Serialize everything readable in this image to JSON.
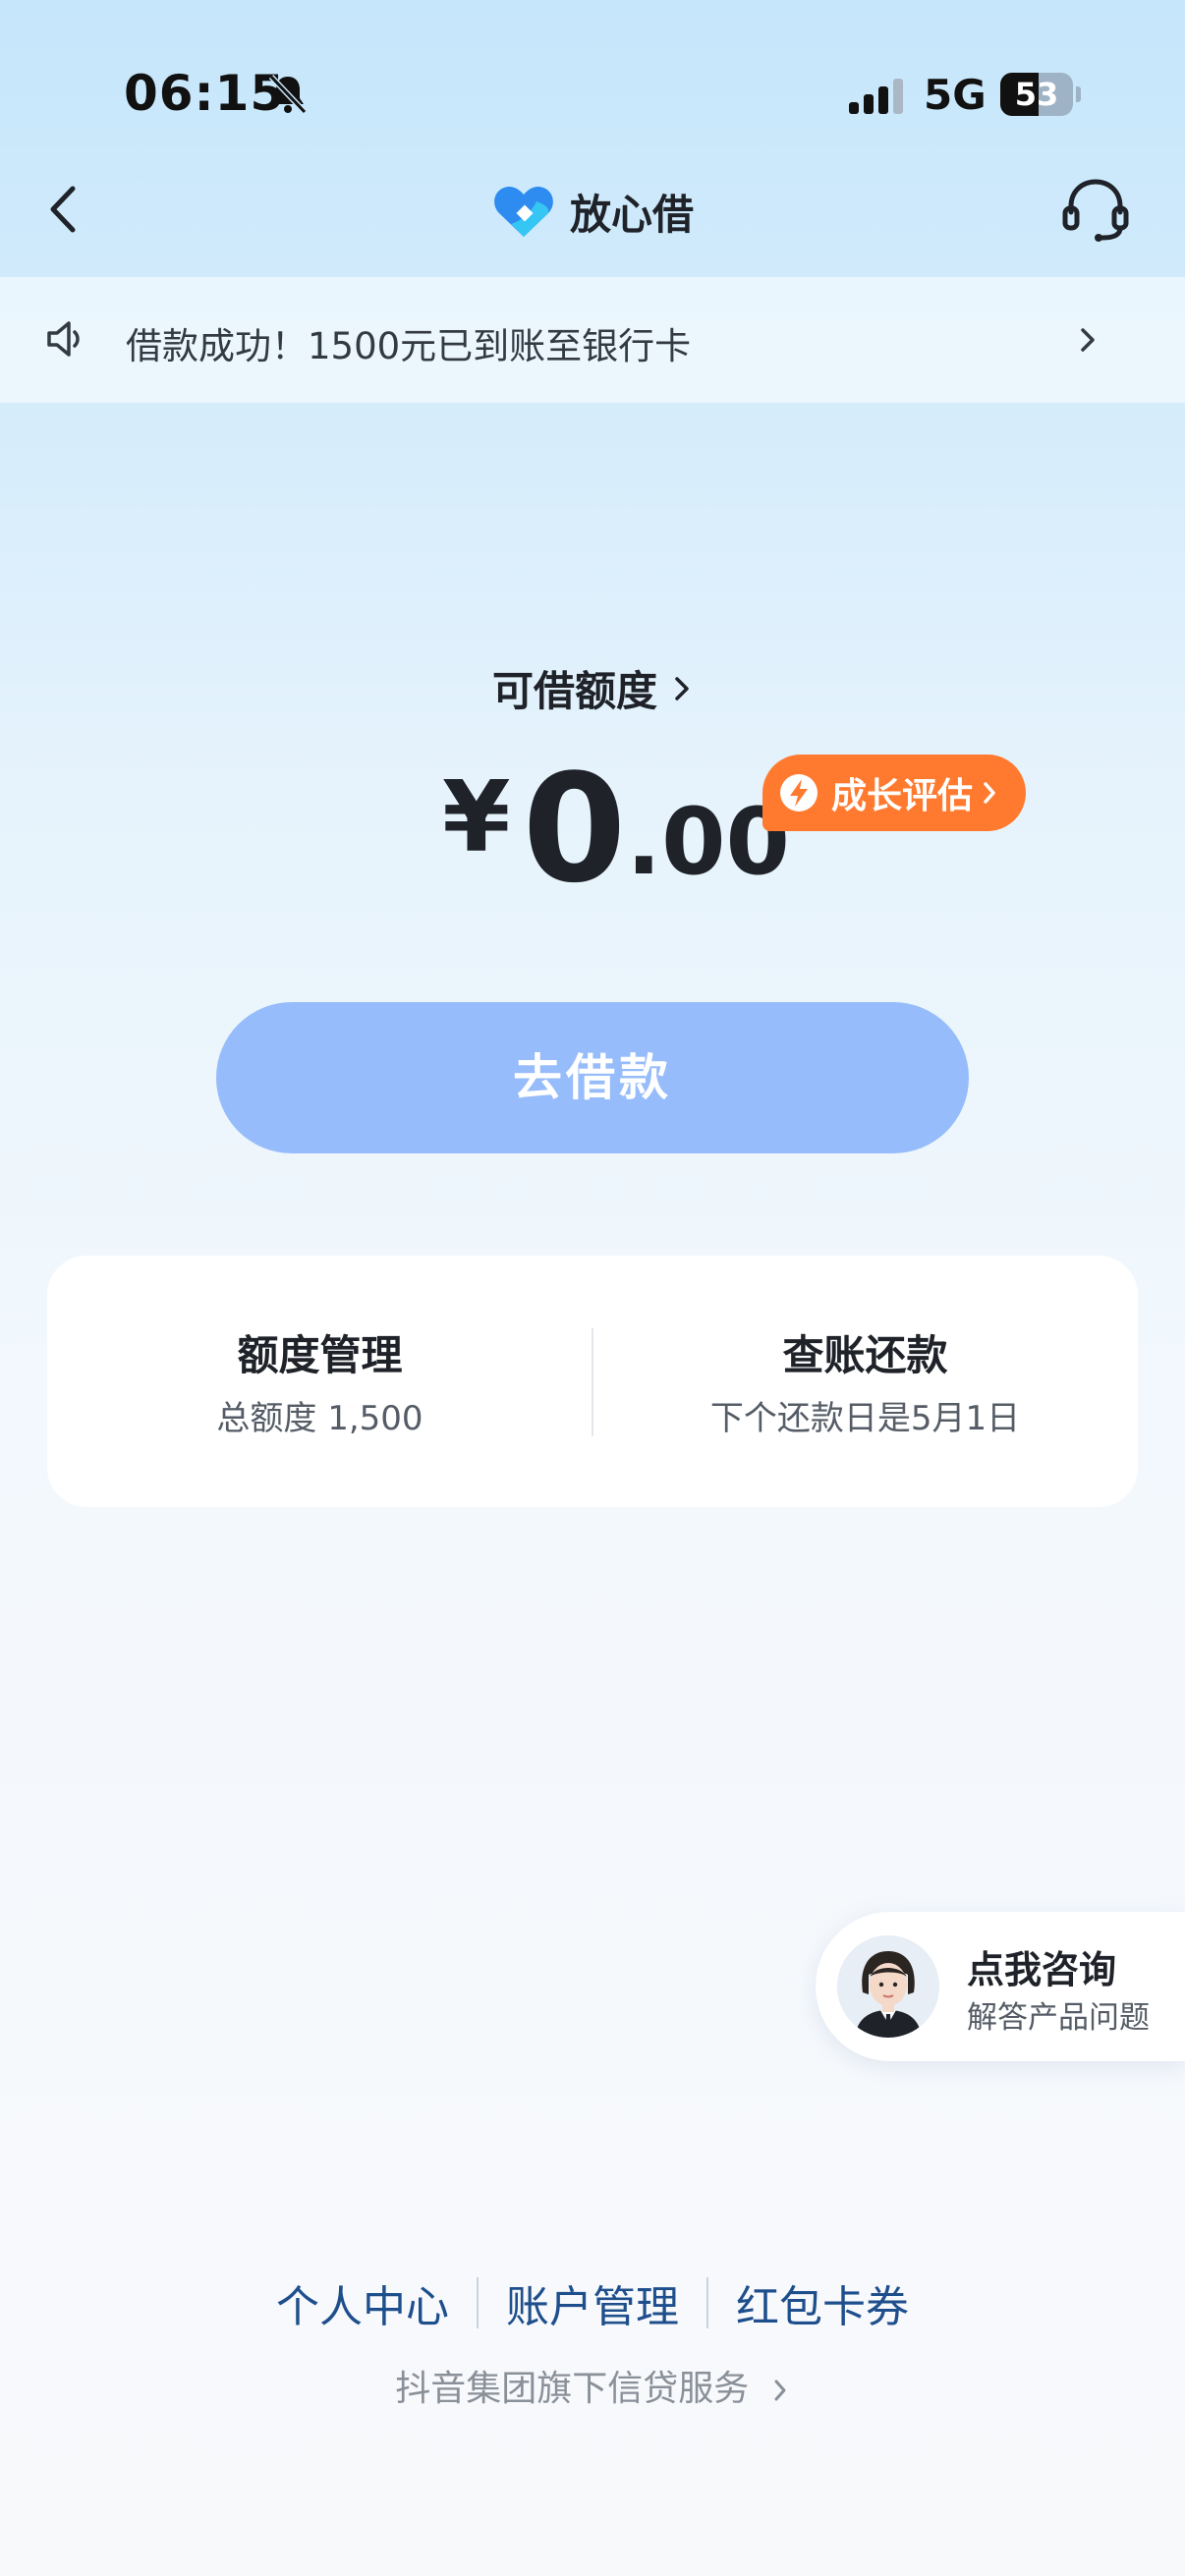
{
  "status_bar": {
    "time": "06:15",
    "network": "5G",
    "battery": "53",
    "battery_level": 0.53,
    "icons": [
      "bell-off-icon",
      "signal-icon",
      "battery-icon"
    ]
  },
  "nav": {
    "title": "放心借",
    "icons": [
      "back-icon",
      "logo-icon",
      "headset-icon"
    ]
  },
  "notice": {
    "text": "借款成功！1500元已到账至银行卡",
    "icons": [
      "speaker-icon",
      "chevron-right-icon"
    ]
  },
  "credit": {
    "label": "可借额度",
    "currency": "¥",
    "amount_int": "0",
    "amount_dec": ".00",
    "badge": "成长评估",
    "badge_color": "#ff7a2f"
  },
  "borrow_button": {
    "label": "去借款",
    "color": "#96bcfb"
  },
  "card": {
    "left": {
      "title": "额度管理",
      "sub": "总额度 1,500"
    },
    "right": {
      "title": "查账还款",
      "sub": "下个还款日是5月1日"
    }
  },
  "consult": {
    "title": "点我咨询",
    "sub": "解答产品问题"
  },
  "footer": {
    "links": [
      "个人中心",
      "账户管理",
      "红包卡券"
    ],
    "sub": "抖音集团旗下信贷服务",
    "link_color": "#1e4f8c"
  }
}
